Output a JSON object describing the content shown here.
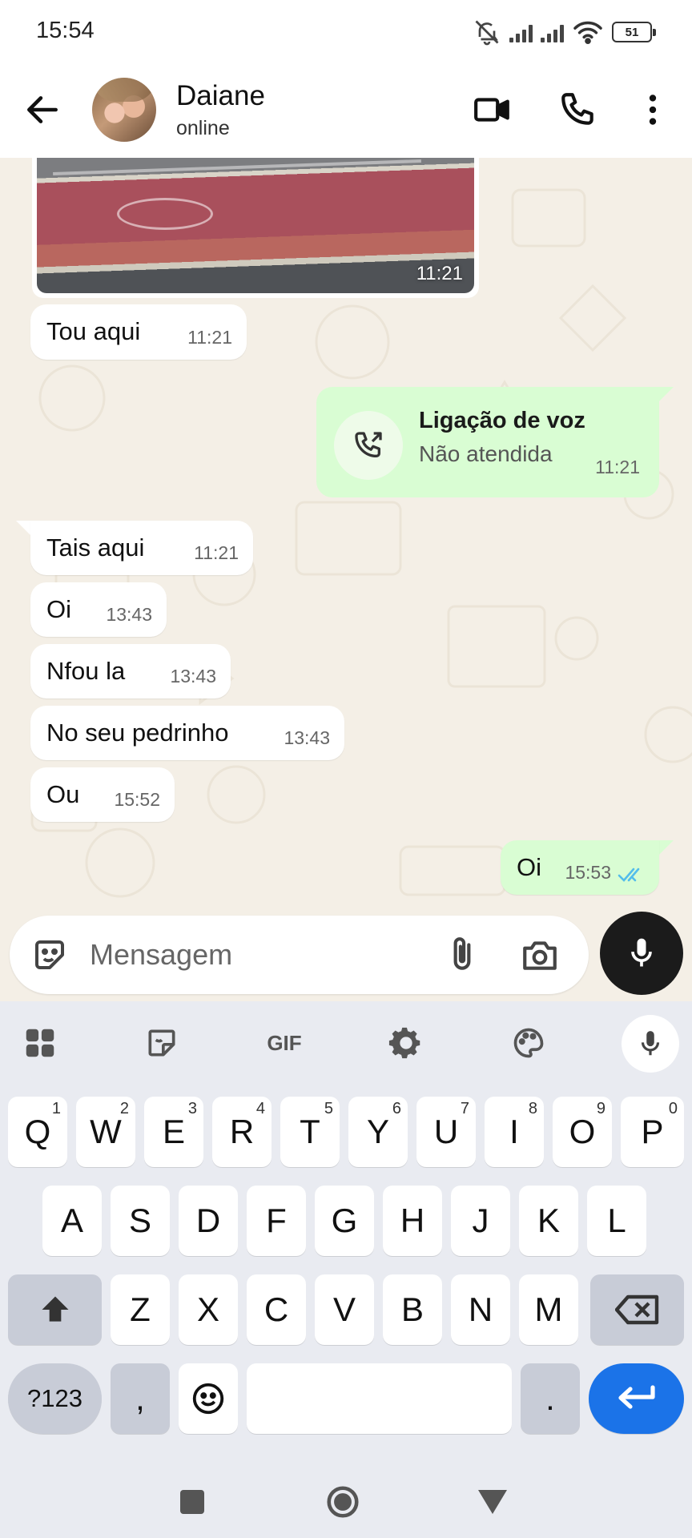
{
  "status_bar": {
    "time": "15:54",
    "battery": "51"
  },
  "header": {
    "contact_name": "Daiane",
    "contact_status": "online"
  },
  "messages": [
    {
      "kind": "image",
      "direction": "in",
      "time": "11:21"
    },
    {
      "kind": "text",
      "direction": "in",
      "text": "Tou aqui",
      "time": "11:21"
    },
    {
      "kind": "call",
      "direction": "out",
      "title": "Ligação de voz",
      "subtitle": "Não atendida",
      "time": "11:21"
    },
    {
      "kind": "text",
      "direction": "in",
      "text": "Tais aqui",
      "time": "11:21"
    },
    {
      "kind": "text",
      "direction": "in",
      "text": "Oi",
      "time": "13:43"
    },
    {
      "kind": "text",
      "direction": "in",
      "text": "Nfou la",
      "time": "13:43"
    },
    {
      "kind": "text",
      "direction": "in",
      "text": "No seu pedrinho",
      "time": "13:43"
    },
    {
      "kind": "text",
      "direction": "in",
      "text": "Ou",
      "time": "15:52"
    },
    {
      "kind": "text",
      "direction": "out",
      "text": "Oi",
      "time": "15:53",
      "read": true
    }
  ],
  "input": {
    "placeholder": "Mensagem",
    "value": ""
  },
  "keyboard": {
    "toolbar": {
      "gif_label": "GIF"
    },
    "row1": [
      {
        "label": "Q",
        "hint": "1"
      },
      {
        "label": "W",
        "hint": "2"
      },
      {
        "label": "E",
        "hint": "3"
      },
      {
        "label": "R",
        "hint": "4"
      },
      {
        "label": "T",
        "hint": "5"
      },
      {
        "label": "Y",
        "hint": "6"
      },
      {
        "label": "U",
        "hint": "7"
      },
      {
        "label": "I",
        "hint": "8"
      },
      {
        "label": "O",
        "hint": "9"
      },
      {
        "label": "P",
        "hint": "0"
      }
    ],
    "row2": [
      "A",
      "S",
      "D",
      "F",
      "G",
      "H",
      "J",
      "K",
      "L"
    ],
    "row3": [
      "Z",
      "X",
      "C",
      "V",
      "B",
      "N",
      "M"
    ],
    "sym_label": "?123",
    "comma": ",",
    "period": "."
  },
  "colors": {
    "chat_background": "#f4efe6",
    "outgoing_bubble": "#d9fdd3",
    "incoming_bubble": "#ffffff",
    "enter_key": "#1b73e8",
    "read_ticks": "#53bdeb"
  },
  "icons": {
    "header": [
      "back-arrow-icon",
      "video-call-icon",
      "phone-icon",
      "more-vert-icon"
    ],
    "input": [
      "emoji-sticker-icon",
      "paperclip-icon",
      "camera-icon",
      "mic-icon"
    ],
    "keyboard_toolbar": [
      "apps-grid-icon",
      "sticker-icon",
      "gif-icon",
      "settings-gear-icon",
      "palette-icon",
      "mic-icon"
    ],
    "navigation": [
      "recents-square-icon",
      "home-circle-icon",
      "back-triangle-icon"
    ]
  }
}
